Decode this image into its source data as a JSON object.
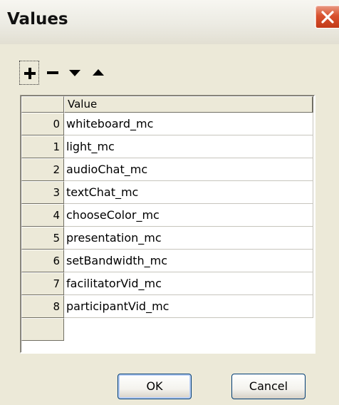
{
  "window": {
    "title": "Values"
  },
  "toolbar": {
    "add_icon": "plus-icon",
    "remove_icon": "minus-icon",
    "down_icon": "triangle-down-icon",
    "up_icon": "triangle-up-icon"
  },
  "grid": {
    "column_header": "Value",
    "rows": [
      {
        "index": "0",
        "value": "whiteboard_mc"
      },
      {
        "index": "1",
        "value": "light_mc"
      },
      {
        "index": "2",
        "value": "audioChat_mc"
      },
      {
        "index": "3",
        "value": "textChat_mc"
      },
      {
        "index": "4",
        "value": "chooseColor_mc"
      },
      {
        "index": "5",
        "value": "presentation_mc"
      },
      {
        "index": "6",
        "value": "setBandwidth_mc"
      },
      {
        "index": "7",
        "value": "facilitatorVid_mc"
      },
      {
        "index": "8",
        "value": "participantVid_mc"
      }
    ]
  },
  "buttons": {
    "ok": "OK",
    "cancel": "Cancel"
  }
}
